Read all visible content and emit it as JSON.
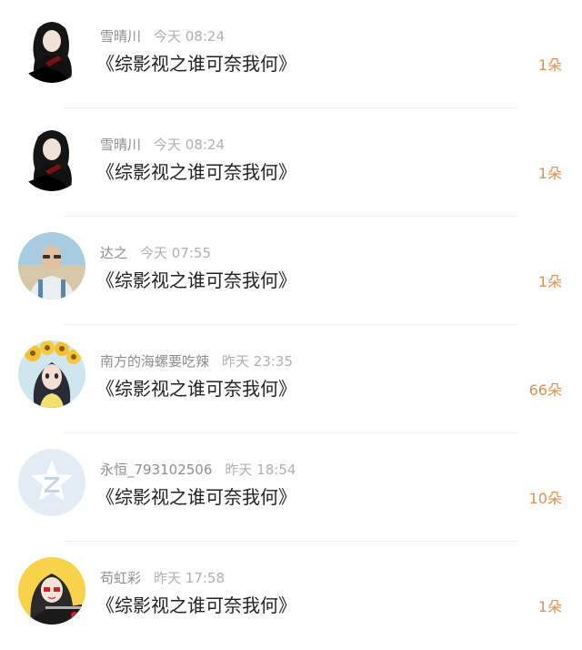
{
  "comments": [
    {
      "username": "雪晴川",
      "time": "今天 08:24",
      "title": "《综影视之谁可奈我何》",
      "gift": "1朵",
      "avatar": "anime-avatar-icon"
    },
    {
      "username": "雪晴川",
      "time": "今天 08:24",
      "title": "《综影视之谁可奈我何》",
      "gift": "1朵",
      "avatar": "anime-avatar-icon"
    },
    {
      "username": "达之",
      "time": "今天 07:55",
      "title": "《综影视之谁可奈我何》",
      "gift": "1朵",
      "avatar": "photo-avatar-icon"
    },
    {
      "username": "南方的海螺要吃辣",
      "time": "昨天 23:35",
      "title": "《综影视之谁可奈我何》",
      "gift": "66朵",
      "avatar": "sunflower-girl-avatar-icon"
    },
    {
      "username": "永恒_793102506",
      "time": "昨天 18:54",
      "title": "《综影视之谁可奈我何》",
      "gift": "10朵",
      "avatar": "default-avatar-icon"
    },
    {
      "username": "苟虹彩",
      "time": "昨天 17:58",
      "title": "《综影视之谁可奈我何》",
      "gift": "1朵",
      "avatar": "anime-girl-avatar-icon"
    }
  ],
  "colors": {
    "gift": "#e2904c",
    "username": "#8e8e8e",
    "time": "#b0b0b0",
    "title": "#222222",
    "divider": "#f0f0f0"
  }
}
